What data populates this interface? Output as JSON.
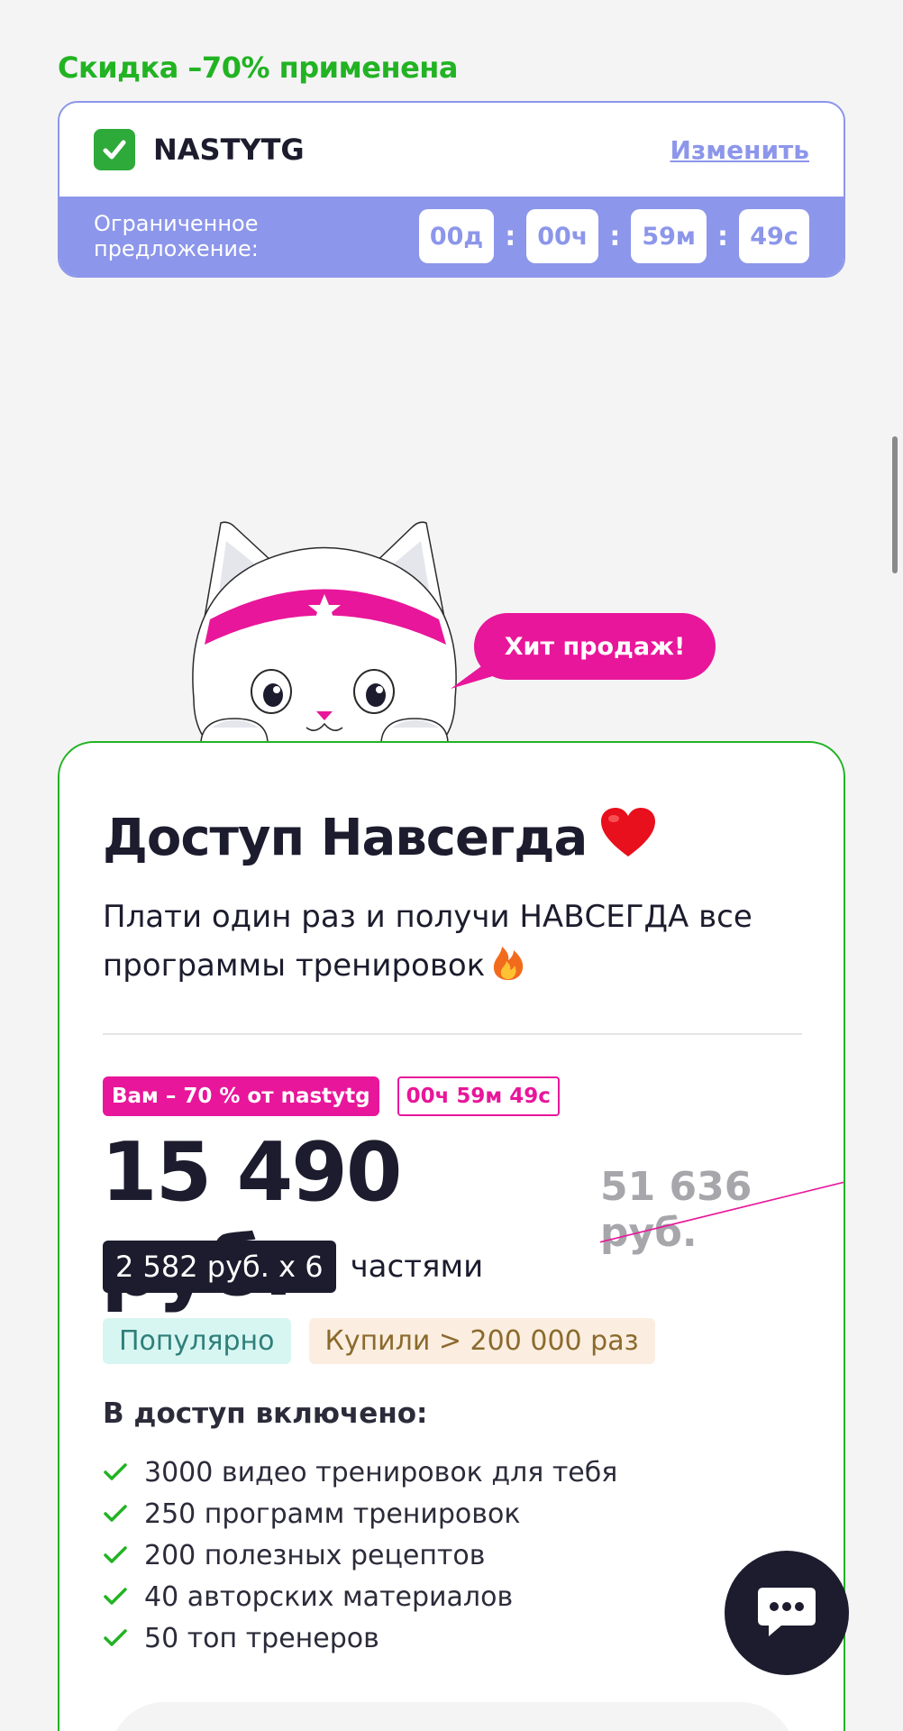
{
  "promo": {
    "discount_label": "Скидка –70% применена",
    "code": "NASTYTG",
    "change_label": "Изменить",
    "limited_offer_label": "Ограниченное предложение:",
    "timer": [
      "00д",
      "00ч",
      "59м",
      "49с"
    ],
    "timer_separator": ":"
  },
  "colors": {
    "accent_green": "#22b323",
    "accent_pink": "#e8169a",
    "accent_purple": "#8c96ea",
    "dark": "#1c1c2e"
  },
  "bubble": {
    "label": "Хит продаж!"
  },
  "plan": {
    "title": "Доступ Навсегда",
    "description": "Плати один раз и получи НАВСЕГДА все программы тренировок",
    "discount_badge": "Вам – 70 % от nastytg",
    "timer_badge": "00ч 59м 49с",
    "price": "15 490 руб.",
    "old_price": "51 636 руб.",
    "installment": "2 582 руб. x 6",
    "installment_suffix": "частями",
    "tag_popular": "Популярно",
    "tag_bought": "Купили > 200 000 раз",
    "includes_title": "В доступ включено:",
    "features": [
      "3000 видео тренировок для тебя",
      "250 программ тренировок",
      "200 полезных рецептов",
      "40 авторских материалов",
      "50 топ тренеров"
    ]
  },
  "icons": {
    "check": "check-icon",
    "heart": "heart-icon",
    "fire": "fire-icon",
    "chat": "chat-icon"
  }
}
